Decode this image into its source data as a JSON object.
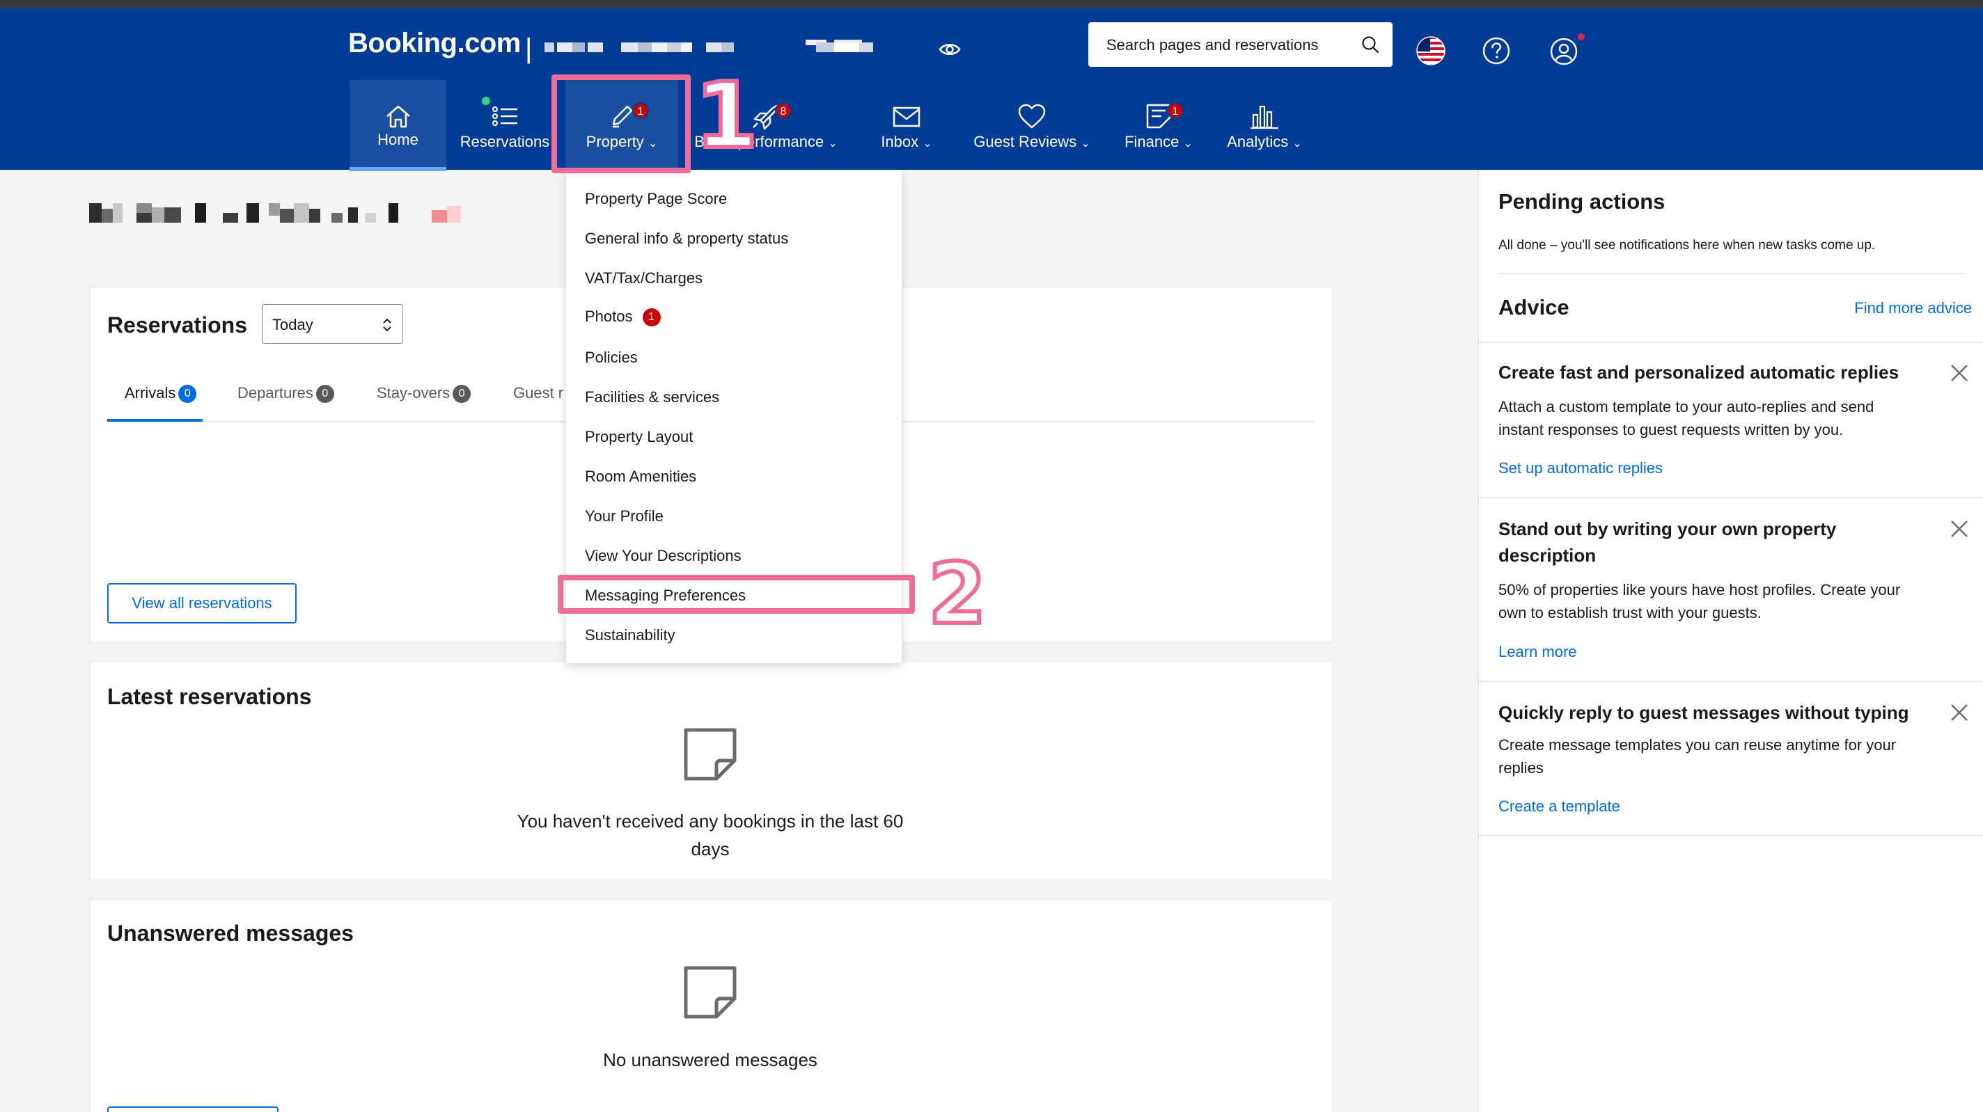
{
  "header": {
    "logo": "Booking.com",
    "logo_separator": "|",
    "search_placeholder": "Search pages and reservations"
  },
  "nav": [
    {
      "label": "Home",
      "icon": "home-icon"
    },
    {
      "label": "Reservations",
      "icon": "list-icon"
    },
    {
      "label": "Property",
      "icon": "pencil-icon",
      "badge": "1"
    },
    {
      "label": "Boost performance",
      "icon": "rocket-icon",
      "badge": "8"
    },
    {
      "label": "Inbox",
      "icon": "mail-icon"
    },
    {
      "label": "Guest Reviews",
      "icon": "heart-icon"
    },
    {
      "label": "Finance",
      "icon": "invoice-icon",
      "badge": "1"
    },
    {
      "label": "Analytics",
      "icon": "bar-chart-icon"
    }
  ],
  "annotations": {
    "step1": "1",
    "step2": "2"
  },
  "property_menu": {
    "items": [
      "Property Page Score",
      "General info & property status",
      "VAT/Tax/Charges",
      "Photos",
      "Policies",
      "Facilities & services",
      "Property Layout",
      "Room Amenities",
      "Your Profile",
      "View Your Descriptions",
      "Messaging Preferences",
      "Sustainability"
    ],
    "photos_badge": "1"
  },
  "reservations": {
    "title": "Reservations",
    "date_select": "Today",
    "tabs": [
      {
        "label": "Arrivals",
        "count": "0"
      },
      {
        "label": "Departures",
        "count": "0"
      },
      {
        "label": "Stay-overs",
        "count": "0"
      },
      {
        "label": "Guest r"
      }
    ],
    "view_all": "View all reservations"
  },
  "latest": {
    "title": "Latest reservations",
    "empty_line1": "You haven't received any bookings in the last 60",
    "empty_line2": "days"
  },
  "unanswered": {
    "title": "Unanswered messages",
    "empty": "No unanswered messages"
  },
  "pending": {
    "title": "Pending actions",
    "text": "All done – you'll see notifications here when new tasks come up."
  },
  "advice": {
    "title": "Advice",
    "find_more": "Find more advice",
    "cards": [
      {
        "title": "Create fast and personalized automatic replies",
        "line1": "Attach a custom template to your auto-replies and send",
        "line2": "instant responses to guest requests written by you.",
        "link": "Set up automatic replies"
      },
      {
        "title_line1": "Stand out by writing your own property",
        "title_line2": "description",
        "line1": "50% of properties like yours have host profiles. Create your",
        "line2": "own to establish trust with your guests.",
        "link": "Learn more"
      },
      {
        "title": "Quickly reply to guest messages without typing",
        "line1": "Create message templates you can reuse anytime for your",
        "line2": "replies",
        "link": "Create a template"
      }
    ]
  },
  "colors": {
    "brand_blue": "#003b95",
    "link_blue": "#006ce4",
    "highlight_pink": "#ef6b9a",
    "badge_red": "#cc0000"
  }
}
